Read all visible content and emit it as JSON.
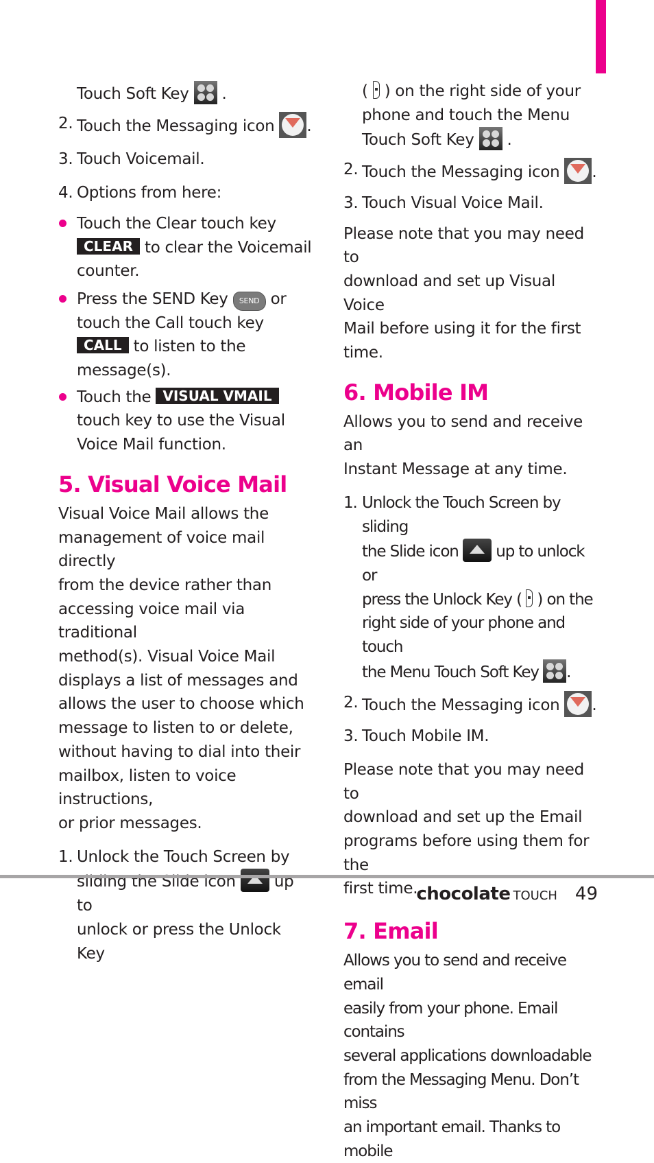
{
  "page": {
    "accent_color": "#ec008c",
    "footer": {
      "brand": "chocolate",
      "brand_suffix": "TOUCH",
      "page_number": "49"
    }
  },
  "left": {
    "intro_cont": "Touch Soft Key",
    "steps_a": [
      {
        "num": "2.",
        "text": "Touch the Messaging icon",
        "icon": "messaging-icon"
      },
      {
        "num": "3.",
        "prefix": "Touch ",
        "bold": "Voicemail",
        "suffix": "."
      },
      {
        "num": "4.",
        "text": "Options from here:"
      }
    ],
    "bullets": [
      {
        "l1": "Touch the Clear touch key",
        "key": "CLEAR",
        "l2": "to clear the Voicemail",
        "l3": "counter."
      },
      {
        "l1": "Press the SEND Key",
        "send": "SEND",
        "l1b": "or",
        "l2": "touch the Call touch key",
        "key": "CALL",
        "l3": "to listen to the",
        "l4": "message(s)."
      },
      {
        "l1": "Touch the",
        "key": "VISUAL VMAIL",
        "l2": "touch key to use the Visual",
        "l3": "Voice Mail function."
      }
    ],
    "section5": {
      "heading": "5. Visual Voice Mail",
      "body_lines": [
        "Visual Voice Mail allows the",
        "management of voice mail directly",
        "from the device rather than",
        "accessing voice mail via traditional",
        "method(s). Visual Voice Mail",
        "displays a list of messages and",
        "allows the user to choose which",
        "message to listen to or delete,",
        "without having to dial into their",
        "mailbox, listen to voice instructions,",
        "or prior messages."
      ],
      "step1": {
        "num": "1.",
        "l1": "Unlock the Touch Screen by",
        "l2a": "sliding the Slide icon",
        "l2b": "up to",
        "l3": "unlock or press the Unlock Key"
      }
    }
  },
  "right": {
    "cont": {
      "l1": "on the right side of your",
      "l2": "phone and touch the Menu",
      "l3": "Touch Soft Key"
    },
    "vvm_steps": [
      {
        "num": "2.",
        "text": "Touch the Messaging icon"
      },
      {
        "num": "3.",
        "prefix": "Touch ",
        "bold": "Visual Voice Mail",
        "suffix": "."
      }
    ],
    "vvm_note": [
      "Please note that you may need to",
      "download and set up Visual Voice",
      "Mail before using it for the first time."
    ],
    "section6": {
      "heading": "6. Mobile IM",
      "intro": [
        "Allows you to send and receive an",
        "Instant Message at any time."
      ],
      "step1": {
        "num": "1.",
        "l1": "Unlock the Touch Screen by sliding",
        "l2a": "the Slide icon",
        "l2b": "up to unlock or",
        "l3a": "press the Unlock Key (",
        "l3b": ") on the",
        "l4": "right side of your phone and touch",
        "l5": "the Menu Touch Soft Key"
      },
      "step2": {
        "num": "2.",
        "text": "Touch the Messaging icon"
      },
      "step3": {
        "num": "3.",
        "prefix": "Touch ",
        "bold": "Mobile IM",
        "suffix": "."
      },
      "note": [
        "Please note that you may need to",
        "download and set up the Email",
        "programs before using them for the",
        "first time."
      ]
    },
    "section7": {
      "heading": "7. Email",
      "body": [
        "Allows you to send and receive email",
        "easily from your phone. Email contains",
        "several applications downloadable",
        "from the Messaging Menu. Don’t miss",
        "an important email. Thanks to mobile"
      ]
    }
  }
}
